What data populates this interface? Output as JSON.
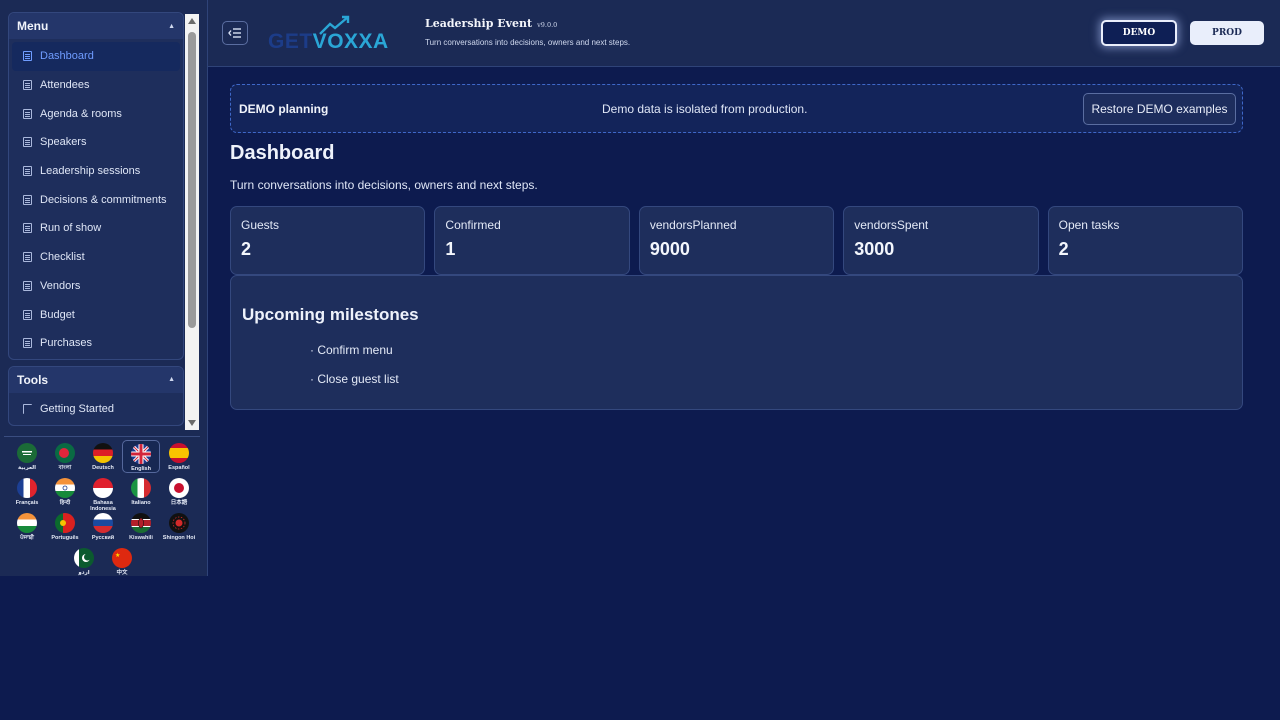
{
  "sidebar": {
    "menu_title": "Menu",
    "menu_items": [
      {
        "label": "Dashboard",
        "active": true
      },
      {
        "label": "Attendees"
      },
      {
        "label": "Agenda & rooms"
      },
      {
        "label": "Speakers"
      },
      {
        "label": "Leadership sessions"
      },
      {
        "label": "Decisions & commitments"
      },
      {
        "label": "Run of show"
      },
      {
        "label": "Checklist"
      },
      {
        "label": "Vendors"
      },
      {
        "label": "Budget"
      },
      {
        "label": "Purchases"
      }
    ],
    "tools_title": "Tools",
    "tools_items": [
      {
        "label": "Getting Started"
      }
    ],
    "languages": [
      {
        "label": "العربية"
      },
      {
        "label": "বাংলা"
      },
      {
        "label": "Deutsch"
      },
      {
        "label": "English",
        "selected": true
      },
      {
        "label": "Español"
      },
      {
        "label": "Français"
      },
      {
        "label": "हिन्दी"
      },
      {
        "label": "Bahasa Indonesia"
      },
      {
        "label": "Italiano"
      },
      {
        "label": "日本語"
      },
      {
        "label": "ਪੰਜਾਬੀ"
      },
      {
        "label": "Português"
      },
      {
        "label": "Русский"
      },
      {
        "label": "Kiswahili"
      },
      {
        "label": "Shingon Hoi"
      },
      {
        "label": "اردو"
      },
      {
        "label": "中文"
      }
    ]
  },
  "header": {
    "logo_text_1": "GET",
    "logo_text_2": "V",
    "logo_text_3": "OXXA",
    "event_title": "Leadership Event",
    "version": "v9.0.0",
    "subtitle": "Turn conversations into decisions, owners and next steps.",
    "demo_label": "DEMO",
    "prod_label": "PROD"
  },
  "banner": {
    "title": "DEMO planning",
    "message": "Demo data is isolated from production.",
    "restore_label": "Restore DEMO examples"
  },
  "main": {
    "title": "Dashboard",
    "subtitle": "Turn conversations into decisions, owners and next steps.",
    "stats": [
      {
        "label": "Guests",
        "value": "2"
      },
      {
        "label": "Confirmed",
        "value": "1"
      },
      {
        "label": "vendorsPlanned",
        "value": "9000"
      },
      {
        "label": "vendorsSpent",
        "value": "3000"
      },
      {
        "label": "Open tasks",
        "value": "2"
      }
    ],
    "milestones_title": "Upcoming milestones",
    "milestones": [
      {
        "text": "· Confirm menu"
      },
      {
        "text": "· Close guest list"
      }
    ]
  },
  "colors": {
    "background": "#0d1b4f",
    "panel": "#1e2e5c",
    "active_text": "#6f9cff",
    "accent_border": "#3f68c9"
  }
}
